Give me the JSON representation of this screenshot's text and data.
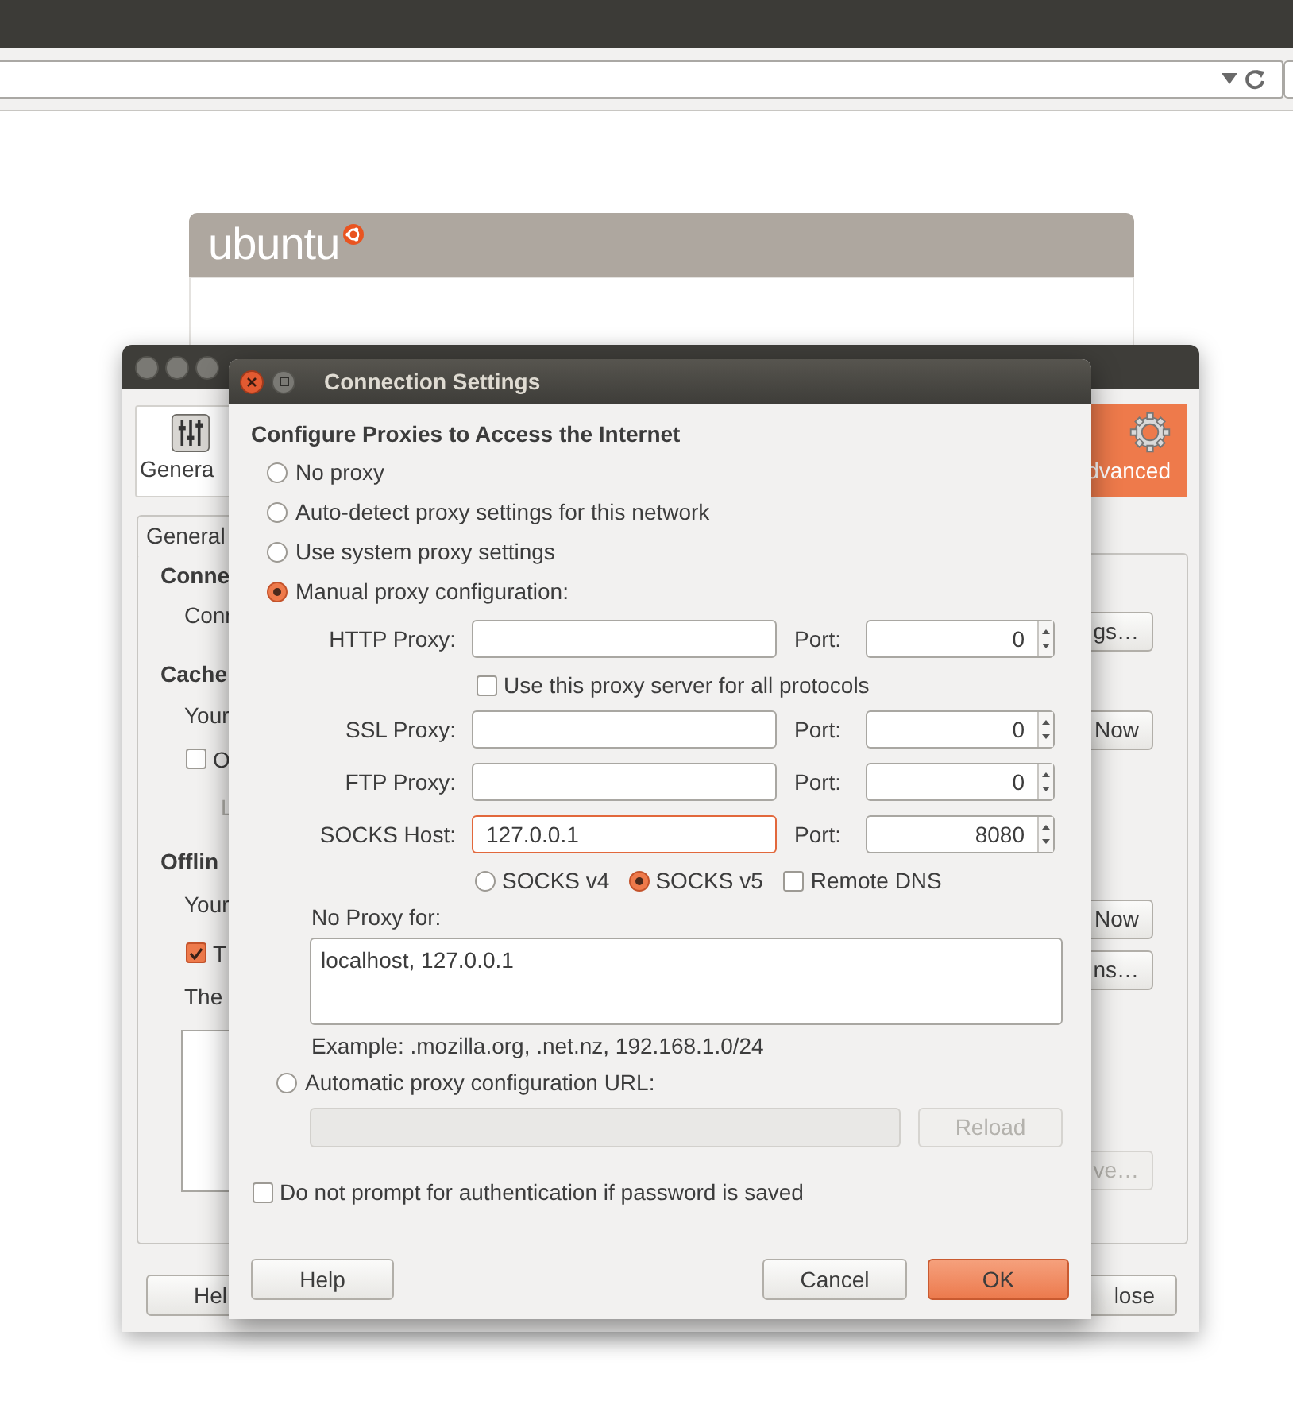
{
  "browser": {
    "page": {
      "logo": "ubuntu"
    }
  },
  "preferences": {
    "toolbar": [
      {
        "label": "Genera",
        "selected": false
      },
      {
        "label": "dvanced",
        "selected": true
      }
    ],
    "tabs": [
      {
        "label": "General",
        "selected": true
      }
    ],
    "items": [
      {
        "kind": "heading",
        "text": "Conne"
      },
      {
        "kind": "text",
        "text": "Conr",
        "disabled": false
      },
      {
        "kind": "heading",
        "text": "Cache"
      },
      {
        "kind": "text",
        "text": "Your",
        "disabled": false
      },
      {
        "kind": "checkbox",
        "text": "O",
        "checked": false
      },
      {
        "kind": "text",
        "text": "L",
        "disabled": true
      },
      {
        "kind": "heading",
        "text": "Offlin"
      },
      {
        "kind": "text",
        "text": "Your",
        "disabled": false
      },
      {
        "kind": "checkbox",
        "text": "T",
        "checked": true
      },
      {
        "kind": "text",
        "text": "The",
        "disabled": false
      },
      {
        "kind": "list"
      }
    ],
    "side_buttons": [
      {
        "label": "gs…",
        "disabled": false
      },
      {
        "label": "Now",
        "disabled": false
      },
      {
        "label": "Now",
        "disabled": false
      },
      {
        "label": "ns…",
        "disabled": false
      },
      {
        "label": "ve…",
        "disabled": true
      }
    ],
    "footer_buttons": [
      "Hel",
      "lose"
    ]
  },
  "dialog": {
    "title": "Connection Settings",
    "heading": "Configure Proxies to Access the Internet",
    "modes": [
      {
        "label": "No proxy",
        "selected": false
      },
      {
        "label": "Auto-detect proxy settings for this network",
        "selected": false
      },
      {
        "label": "Use system proxy settings",
        "selected": false
      },
      {
        "label": "Manual proxy configuration:",
        "selected": true
      },
      {
        "label": "Automatic proxy configuration URL:",
        "selected": false
      }
    ],
    "proxies": [
      {
        "label": "HTTP Proxy:",
        "port_label": "Port:",
        "port": "0",
        "focused": false
      },
      {
        "label": "SSL Proxy:",
        "port_label": "Port:",
        "port": "0",
        "focused": false
      },
      {
        "label": "FTP Proxy:",
        "port_label": "Port:",
        "port": "0",
        "focused": false
      },
      {
        "label": "SOCKS Host:",
        "value": "127.0.0.1",
        "port_label": "Port:",
        "port": "8080",
        "focused": true
      }
    ],
    "share_all": {
      "label": "Use this proxy server for all protocols",
      "checked": false
    },
    "socks_versions": [
      {
        "label": "SOCKS v4",
        "selected": false
      },
      {
        "label": "SOCKS v5",
        "selected": true
      }
    ],
    "remote_dns": {
      "label": "Remote DNS",
      "checked": false
    },
    "no_proxy": {
      "label": "No Proxy for:",
      "value": "localhost, 127.0.0.1",
      "example": "Example: .mozilla.org, .net.nz, 192.168.1.0/24"
    },
    "reload": {
      "label": "Reload",
      "disabled": true
    },
    "auth": {
      "label": "Do not prompt for authentication if password is saved",
      "checked": false
    },
    "buttons": [
      {
        "label": "Help",
        "default": false
      },
      {
        "label": "Cancel",
        "default": false
      },
      {
        "label": "OK",
        "default": true
      }
    ]
  }
}
